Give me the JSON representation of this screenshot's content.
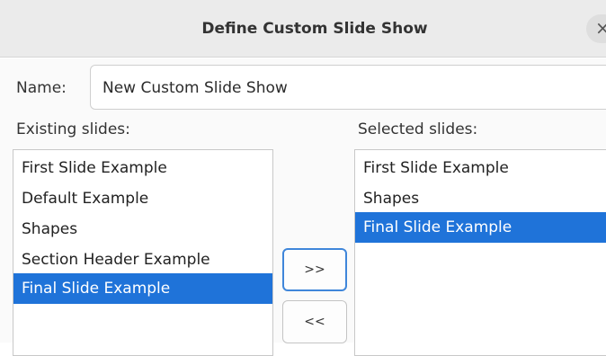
{
  "dialog": {
    "title": "Define Custom Slide Show",
    "close_glyph": "×"
  },
  "name": {
    "label": "Name:",
    "value": "New Custom Slide Show"
  },
  "existing": {
    "label": "Existing slides:",
    "items": [
      {
        "label": "First Slide Example",
        "selected": false
      },
      {
        "label": "Default Example",
        "selected": false
      },
      {
        "label": "Shapes",
        "selected": false
      },
      {
        "label": "Section Header Example",
        "selected": false
      },
      {
        "label": "Final Slide Example",
        "selected": true
      }
    ]
  },
  "selected": {
    "label": "Selected slides:",
    "items": [
      {
        "label": "First Slide Example",
        "selected": false
      },
      {
        "label": "Shapes",
        "selected": false
      },
      {
        "label": "Final Slide Example",
        "selected": true
      }
    ]
  },
  "buttons": {
    "add_label": ">>",
    "remove_label": "<<"
  },
  "colors": {
    "selection": "#1f73d9",
    "focus_border": "#3f86da"
  },
  "icons": {
    "close": "close-icon"
  }
}
